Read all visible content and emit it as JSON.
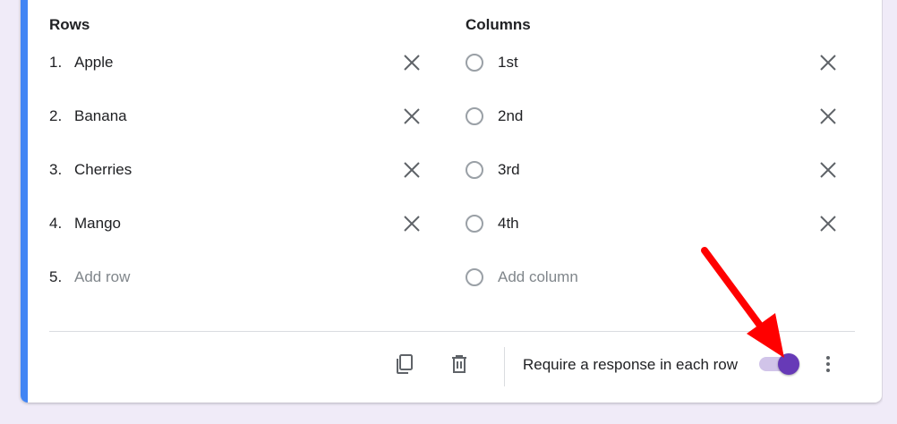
{
  "rows": {
    "title": "Rows",
    "items": [
      {
        "num": "1.",
        "label": "Apple"
      },
      {
        "num": "2.",
        "label": "Banana"
      },
      {
        "num": "3.",
        "label": "Cherries"
      },
      {
        "num": "4.",
        "label": "Mango"
      }
    ],
    "add": {
      "num": "5.",
      "label": "Add row"
    }
  },
  "columns": {
    "title": "Columns",
    "items": [
      {
        "label": "1st"
      },
      {
        "label": "2nd"
      },
      {
        "label": "3rd"
      },
      {
        "label": "4th"
      }
    ],
    "add": {
      "label": "Add column"
    }
  },
  "footer": {
    "require_label": "Require a response in each row",
    "require_enabled": true
  },
  "colors": {
    "accent": "#4285f4",
    "toggle": "#673ab7",
    "arrow": "#ff0000"
  },
  "icons": {
    "remove": "close-icon",
    "duplicate": "copy-icon",
    "delete": "trash-icon",
    "more": "more-vert-icon"
  }
}
